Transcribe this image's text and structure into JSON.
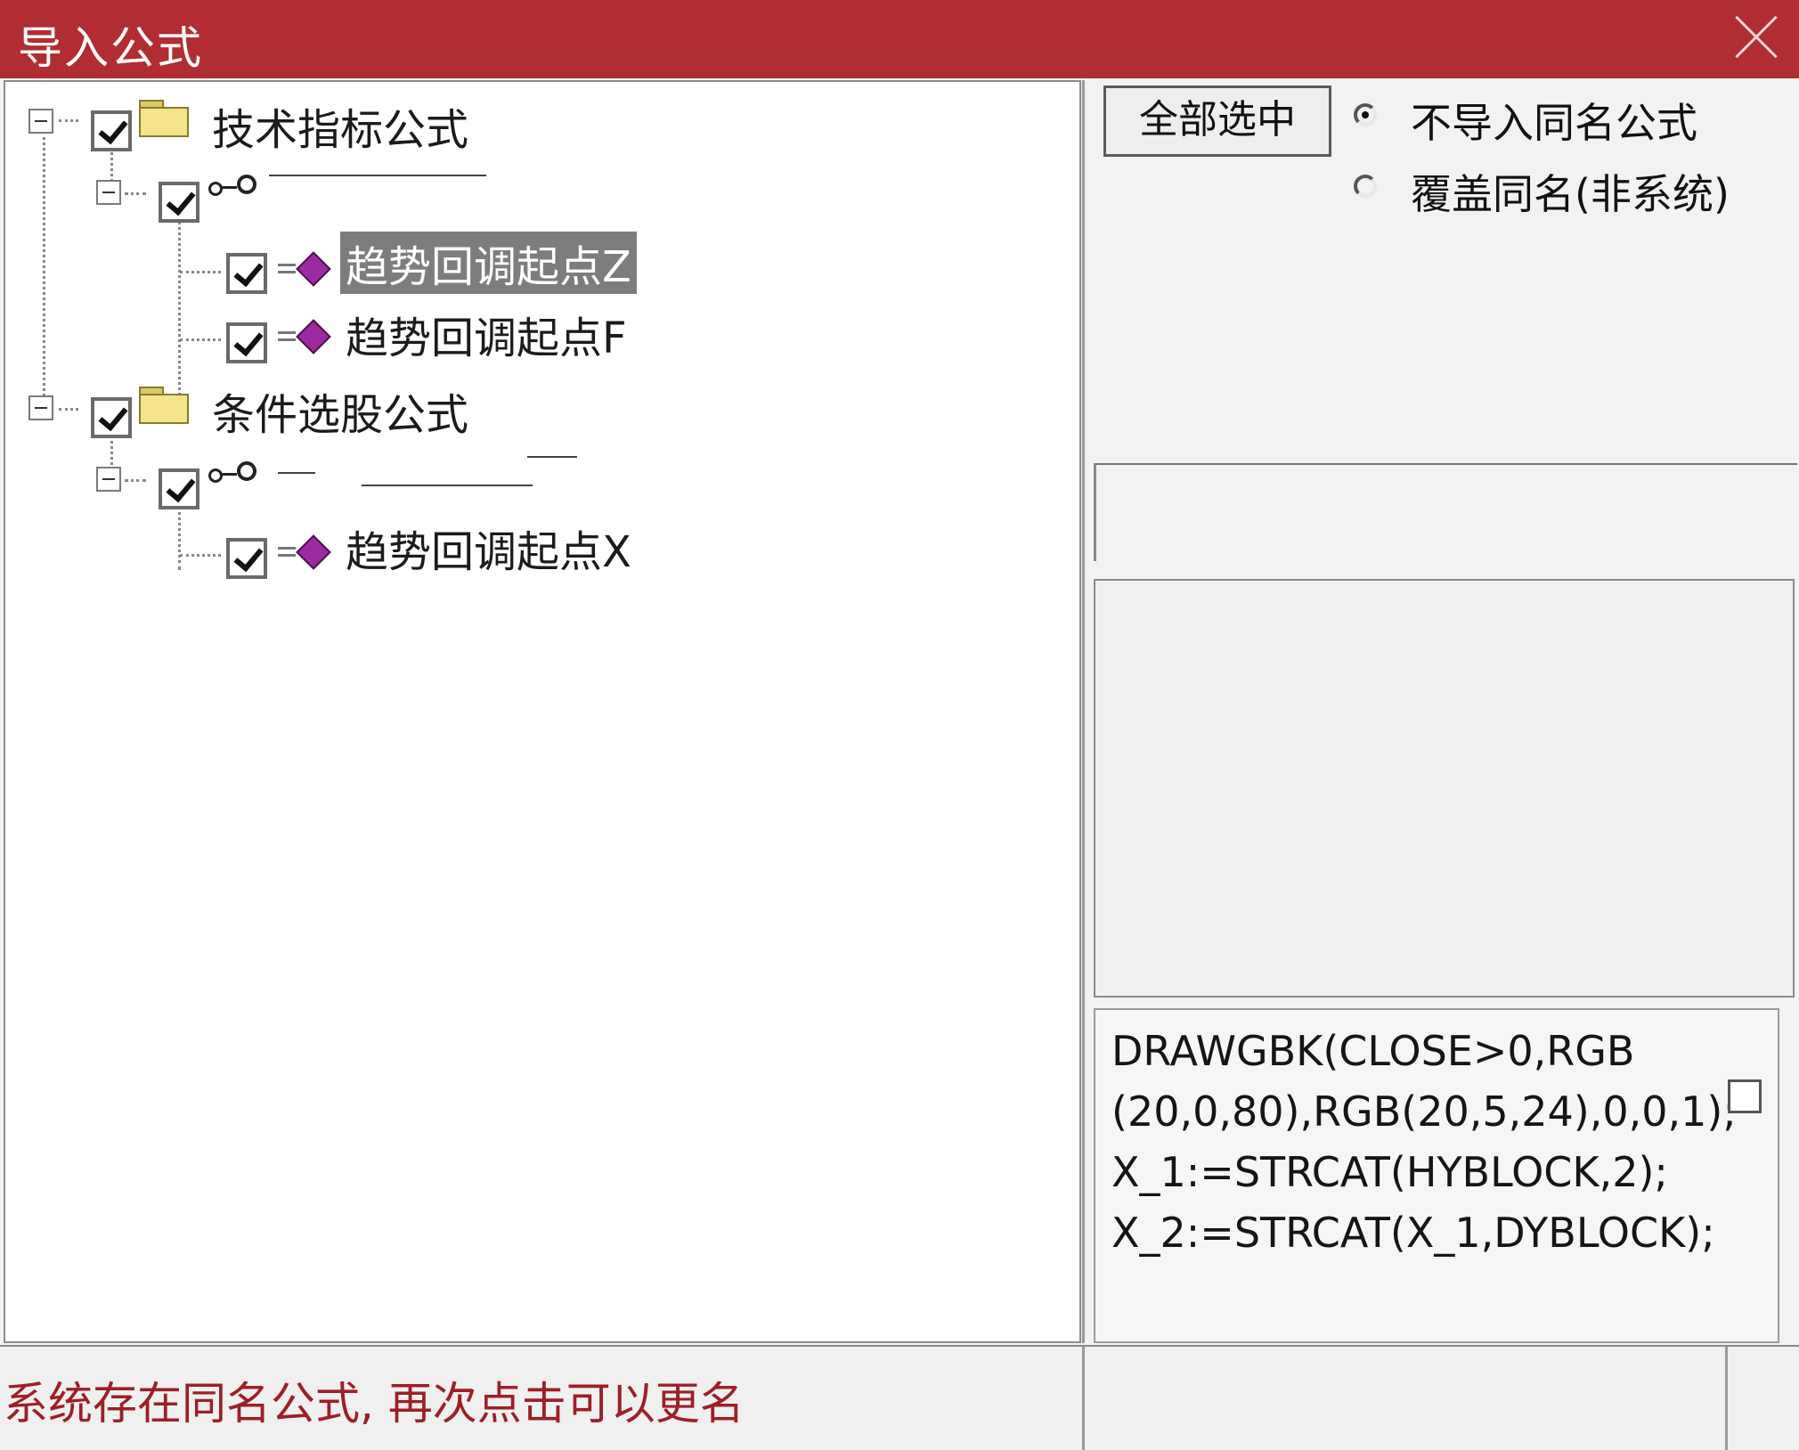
{
  "window": {
    "title": "导入公式",
    "close_icon": "close-icon"
  },
  "tree": {
    "groups": [
      {
        "label": "技术指标公式",
        "checked": true,
        "expanded": true,
        "children": [
          {
            "label": "",
            "icon": "key-icon",
            "checked": true,
            "items": [
              {
                "label": "趋势回调起点Z",
                "checked": true,
                "selected": true
              },
              {
                "label": "趋势回调起点F",
                "checked": true,
                "selected": false
              }
            ]
          }
        ]
      },
      {
        "label": "条件选股公式",
        "checked": true,
        "expanded": true,
        "children": [
          {
            "label": "",
            "icon": "key-icon",
            "checked": true,
            "items": [
              {
                "label": "趋势回调起点X",
                "checked": true,
                "selected": false
              }
            ]
          }
        ]
      }
    ]
  },
  "toolbar": {
    "select_all_label": "全部选中"
  },
  "options": {
    "radio1_label": "不导入同名公式",
    "radio1_selected": true,
    "radio2_label": "覆盖同名(非系统)",
    "radio2_selected": false
  },
  "code": {
    "lines": [
      "DRAWGBK(CLOSE>0,RGB",
      "(20,0,80),RGB(20,5,24),0,0,1);",
      "X_1:=STRCAT(HYBLOCK,2);",
      "X_2:=STRCAT(X_1,DYBLOCK);"
    ]
  },
  "status": {
    "message": "系统存在同名公式, 再次点击可以更名"
  }
}
